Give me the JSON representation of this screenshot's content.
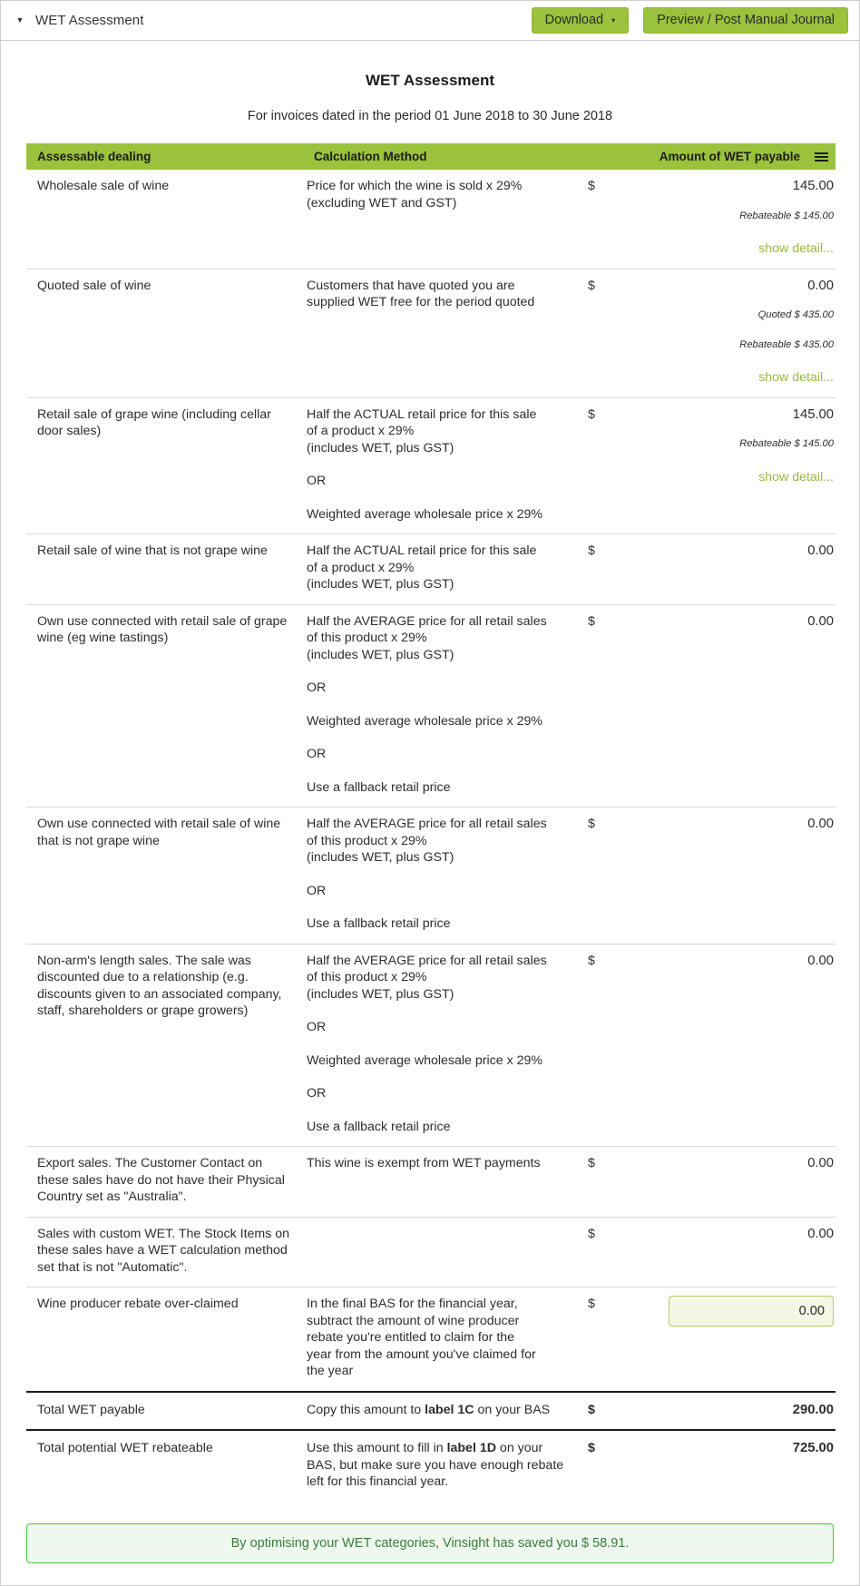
{
  "panel": {
    "title": "WET Assessment",
    "collapse_icon": "caret-down-icon",
    "download_label": "Download",
    "download_caret": "▾",
    "preview_label": "Preview / Post Manual Journal"
  },
  "report": {
    "title": "WET Assessment",
    "subtitle": "For invoices dated in the period 01 June 2018 to 30 June 2018"
  },
  "table": {
    "headers": {
      "dealing": "Assessable dealing",
      "method": "Calculation Method",
      "amount": "Amount of WET payable",
      "menu_icon": "hamburger-menu-icon"
    },
    "currency_symbol": "$",
    "show_detail_label": "show detail...",
    "rows": [
      {
        "dealing": "Wholesale sale of wine",
        "method_lines": [
          "Price for which the wine is sold x 29%",
          "(excluding WET and GST)"
        ],
        "amount": "145.00",
        "notes": [
          "Rebateable $ 145.00"
        ],
        "has_show_detail": true
      },
      {
        "dealing": "Quoted sale of wine",
        "method_lines": [
          "Customers that have quoted you are",
          "supplied WET free for the period quoted"
        ],
        "amount": "0.00",
        "notes": [
          "Quoted $ 435.00",
          "Rebateable $ 435.00"
        ],
        "has_show_detail": true
      },
      {
        "dealing": "Retail sale of grape wine (including cellar door sales)",
        "method_lines": [
          "Half the ACTUAL retail price for this sale",
          "of a product x 29%",
          "(includes WET, plus GST)"
        ],
        "method_extra": [
          "OR",
          "Weighted average wholesale price x 29%"
        ],
        "amount": "145.00",
        "notes": [
          "Rebateable $ 145.00"
        ],
        "has_show_detail": true
      },
      {
        "dealing": "Retail sale of wine that is not grape wine",
        "method_lines": [
          "Half the ACTUAL retail price for this sale",
          "of a product x 29%",
          "(includes WET, plus GST)"
        ],
        "method_extra": [],
        "amount": "0.00",
        "notes": [],
        "has_show_detail": false
      },
      {
        "dealing": "Own use connected with retail sale of grape wine (eg wine tastings)",
        "method_lines": [
          "Half the AVERAGE price for all retail sales",
          "of this product x 29%",
          "(includes WET, plus GST)"
        ],
        "method_extra": [
          "OR",
          "Weighted average wholesale price x 29%",
          "OR",
          "Use a fallback retail price"
        ],
        "amount": "0.00",
        "notes": [],
        "has_show_detail": false
      },
      {
        "dealing": "Own use connected with retail sale of wine that is not grape wine",
        "method_lines": [
          "Half the AVERAGE price for all retail sales",
          "of this product x 29%",
          "(includes WET, plus GST)"
        ],
        "method_extra": [
          "OR",
          "Use a fallback retail price"
        ],
        "amount": "0.00",
        "notes": [],
        "has_show_detail": false
      },
      {
        "dealing": "Non-arm's length sales. The sale was discounted due to a relationship (e.g. discounts given to an associated company, staff, shareholders or grape growers)",
        "method_lines": [
          "Half the AVERAGE price for all retail sales",
          "of this product x 29%",
          "(includes WET, plus GST)"
        ],
        "method_extra": [
          "OR",
          "Weighted average wholesale price x 29%",
          "OR",
          "Use a fallback retail price"
        ],
        "amount": "0.00",
        "notes": [],
        "has_show_detail": false
      },
      {
        "dealing": "Export sales. The Customer Contact on these sales have do not have their Physical Country set as \"Australia\".",
        "method_lines": [
          "This wine is exempt from WET payments"
        ],
        "method_extra": [],
        "amount": "0.00",
        "notes": [],
        "has_show_detail": false
      },
      {
        "dealing": "Sales with custom WET. The Stock Items on these sales have a WET calculation method set that is not \"Automatic\".",
        "method_lines": [],
        "method_extra": [],
        "amount": "0.00",
        "notes": [],
        "has_show_detail": false
      }
    ],
    "rebate_row": {
      "dealing": "Wine producer rebate over-claimed",
      "method_lines": [
        "In the final BAS for the financial year,",
        "subtract the amount of wine producer",
        "rebate you're entitled to claim for the",
        "year from the amount you've claimed for",
        "the year"
      ],
      "input_value": "0.00",
      "input_placeholder": "0.00"
    },
    "totals": [
      {
        "dealing": "Total WET payable",
        "method_pre": "Copy this amount to ",
        "method_bold": "label 1C",
        "method_post": " on your BAS",
        "amount": "290.00"
      },
      {
        "dealing": "Total potential WET rebateable",
        "method_pre": "Use this amount to fill in ",
        "method_bold": "label 1D",
        "method_post": " on your BAS, but make sure you have enough rebate left for this financial year.",
        "amount": "725.00"
      }
    ]
  },
  "banner": {
    "message": "By optimising your WET categories, Vinsight has saved you $ 58.91."
  },
  "colors": {
    "brand_green": "#9ac23c",
    "link_green": "#97b93f",
    "banner_border": "#49c44a",
    "banner_bg": "#eef8ee",
    "banner_text": "#3a7d3c",
    "input_bg": "#f2f8e4",
    "input_border": "#b5ce68"
  }
}
